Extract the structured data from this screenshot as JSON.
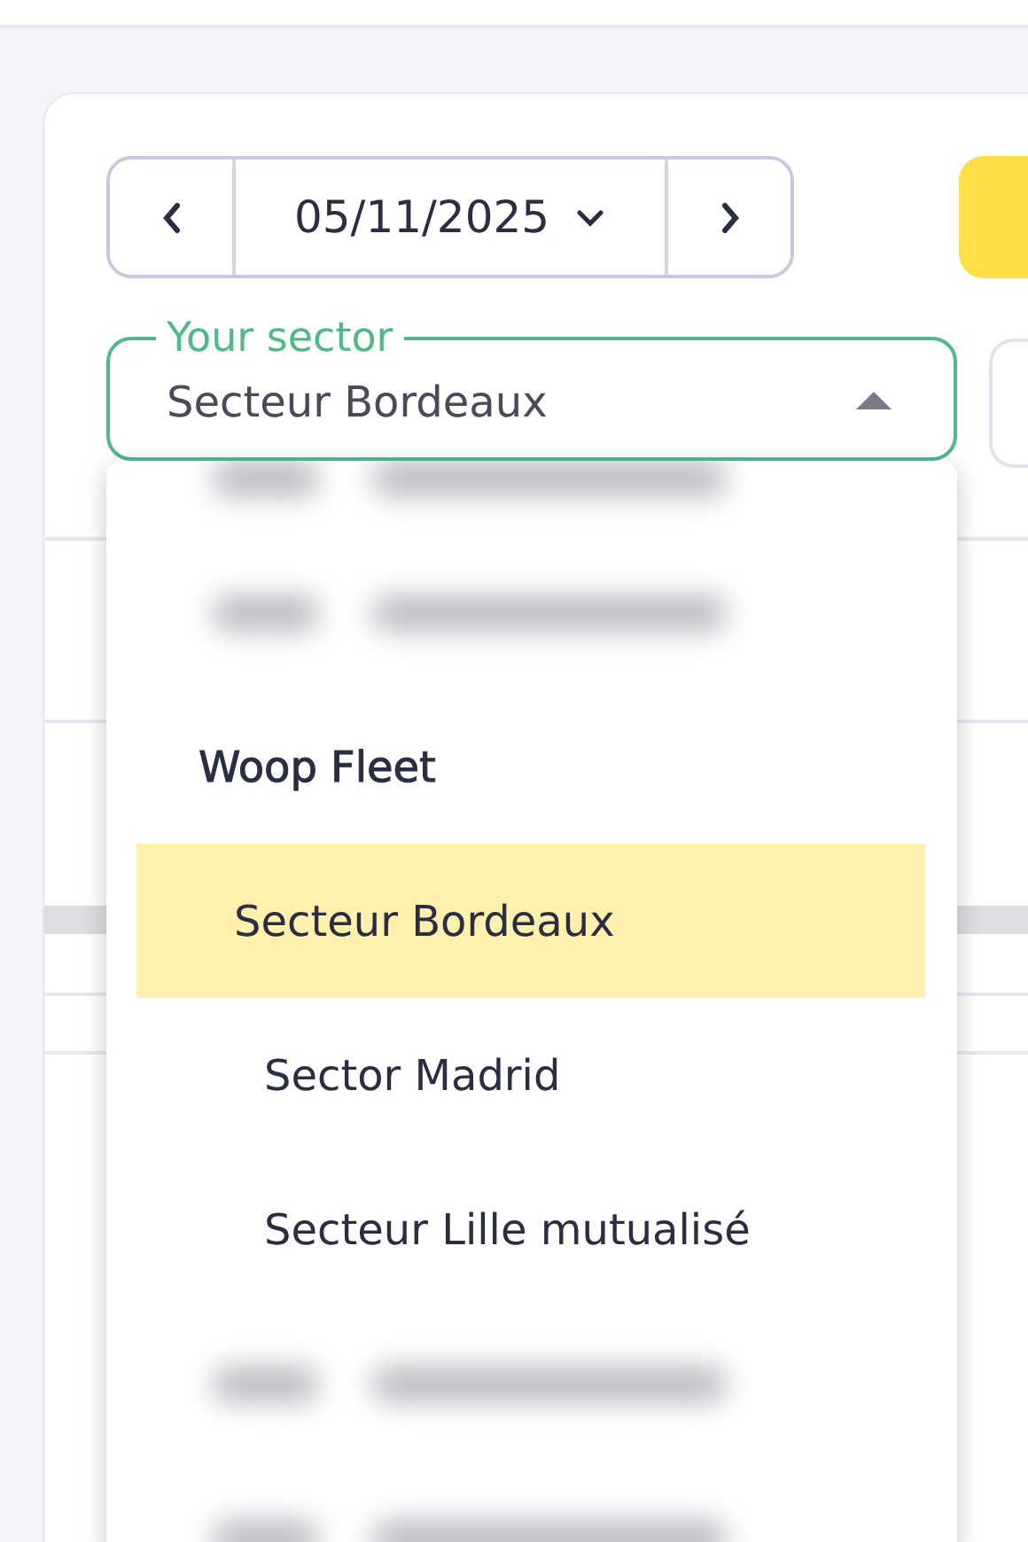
{
  "date_picker": {
    "date": "05/11/2025"
  },
  "sector_select": {
    "label": "Your sector",
    "value": "Secteur Bordeaux",
    "expanded": true
  },
  "dropdown": [
    {
      "kind": "blurred"
    },
    {
      "kind": "blurred"
    },
    {
      "kind": "group",
      "label": "Woop Fleet"
    },
    {
      "kind": "option",
      "label": "Secteur Bordeaux",
      "selected": true
    },
    {
      "kind": "option",
      "label": "Sector Madrid",
      "selected": false
    },
    {
      "kind": "option",
      "label": "Secteur Lille mutualisé",
      "selected": false
    },
    {
      "kind": "blurred"
    },
    {
      "kind": "blurred"
    }
  ]
}
